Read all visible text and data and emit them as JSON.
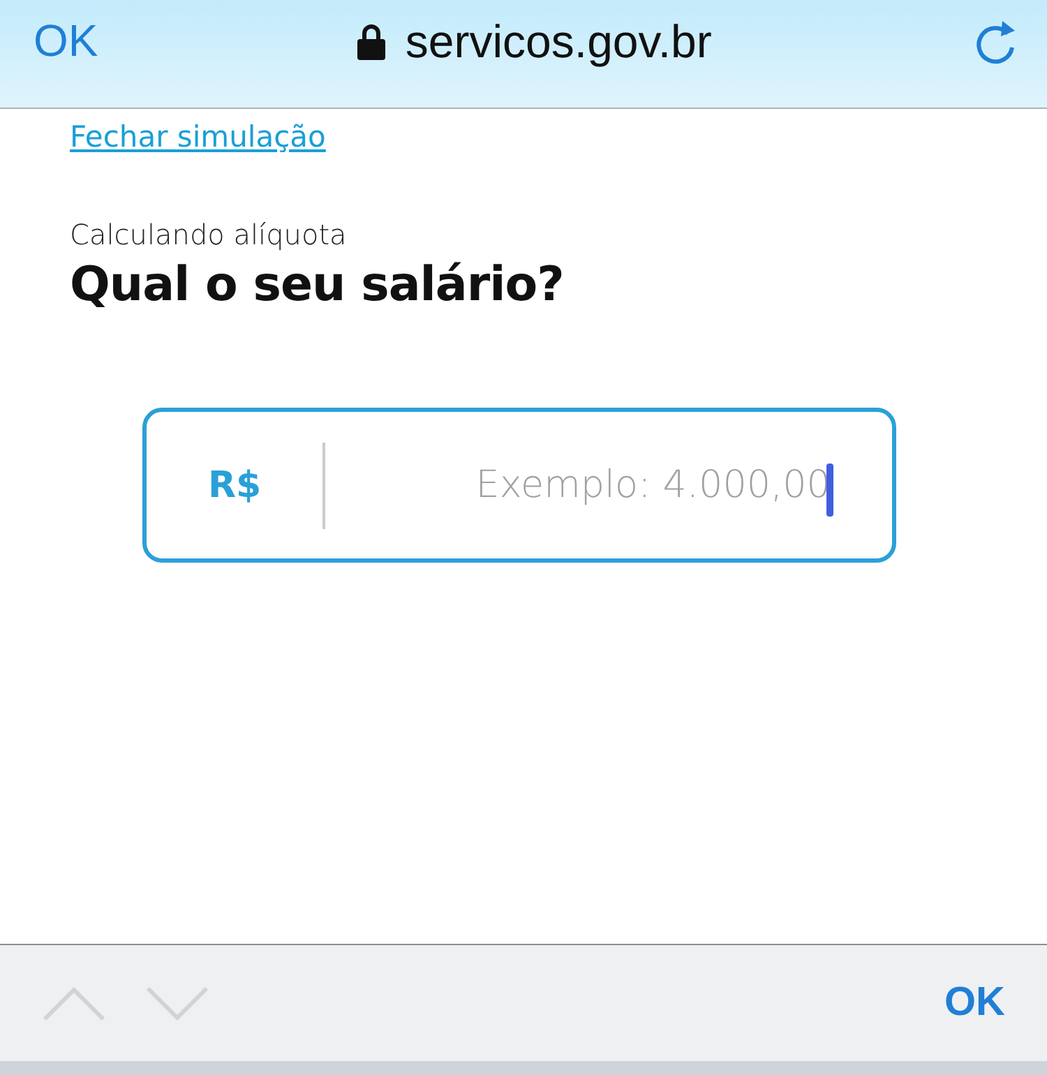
{
  "browser_bar": {
    "done_label": "OK",
    "address": "servicos.gov.br",
    "secure": true
  },
  "page": {
    "close_link": "Fechar simulação",
    "subtitle": "Calculando alíquota",
    "title": "Qual o seu salário?",
    "salary_field": {
      "prefix": "R$",
      "placeholder": "Exemplo: 4.000,00",
      "focused": true
    }
  },
  "keyboard_toolbar": {
    "previous": {
      "disabled": true
    },
    "next": {
      "disabled": true
    },
    "done_label": "OK"
  }
}
